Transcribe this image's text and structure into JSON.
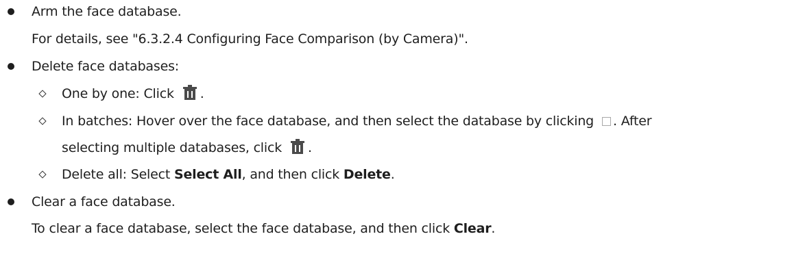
{
  "items": [
    {
      "title": "Arm the face database.",
      "detail": "For details, see \"6.3.2.4 Configuring Face Comparison (by Camera)\"."
    },
    {
      "title": "Delete face databases:",
      "sub": {
        "one_prefix": "One by one: Click",
        "one_suffix": ".",
        "batch_line1_prefix": "In batches: Hover over the face database, and then select the database by clicking",
        "batch_line1_suffix": ". After",
        "batch_line2_prefix": "selecting multiple databases, click",
        "batch_line2_suffix": ".",
        "all_prefix": "Delete all: Select ",
        "all_bold1": "Select All",
        "all_mid": ", and then click ",
        "all_bold2": "Delete",
        "all_suffix": "."
      }
    },
    {
      "title": "Clear a face database.",
      "detail_prefix": "To clear a face database, select the face database, and then click ",
      "detail_bold": "Clear",
      "detail_suffix": "."
    }
  ],
  "icons": {
    "trash": "trash-icon",
    "checkbox": "checkbox-icon"
  },
  "colors": {
    "text": "#1e1e1e",
    "icon_fill": "#4a4a4a"
  }
}
